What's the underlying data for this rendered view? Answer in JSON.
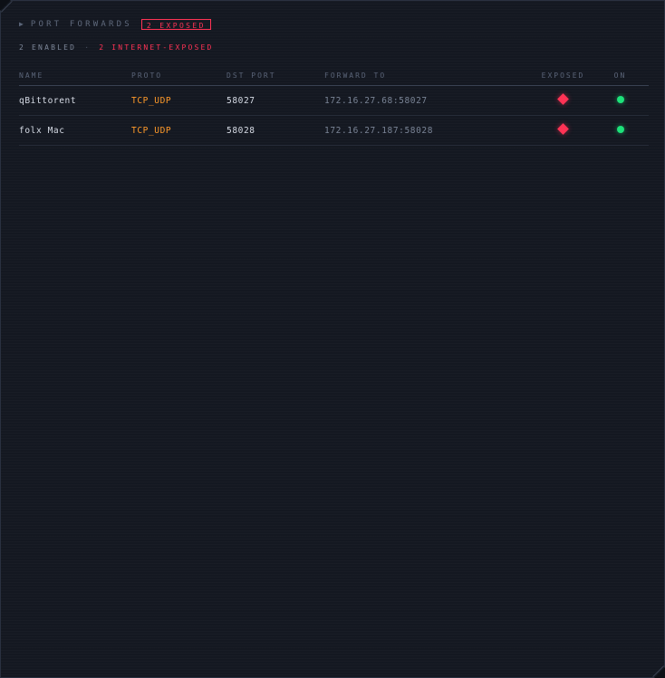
{
  "header": {
    "toggle_glyph": "▶",
    "title": "PORT FORWARDS",
    "exposed_badge": "2 EXPOSED"
  },
  "summary": {
    "enabled": "2 ENABLED",
    "separator": "·",
    "internet_exposed": "2 INTERNET-EXPOSED"
  },
  "table": {
    "columns": [
      "NAME",
      "PROTO",
      "DST PORT",
      "FORWARD TO",
      "EXPOSED",
      "ON"
    ],
    "rows": [
      {
        "name": "qBittorent",
        "proto": "TCP_UDP",
        "dst_port": "58027",
        "forward_to": "172.16.27.68:58027",
        "exposed": true,
        "on": true
      },
      {
        "name": "folx Mac",
        "proto": "TCP_UDP",
        "dst_port": "58028",
        "forward_to": "172.16.27.187:58028",
        "exposed": true,
        "on": true
      }
    ]
  },
  "colors": {
    "accent_red": "#ff3355",
    "proto_orange": "#ff9a2a",
    "status_green": "#1de27a",
    "background": "#141821"
  },
  "icons": {
    "exposed": "red-diamond-icon",
    "on": "green-dot-icon",
    "toggle": "triangle-right-icon"
  }
}
